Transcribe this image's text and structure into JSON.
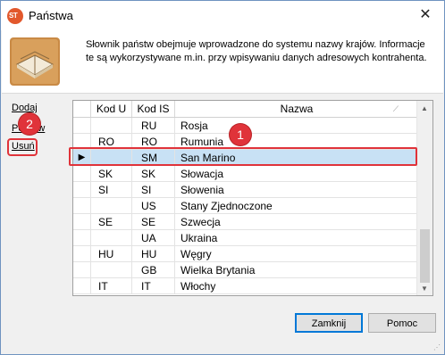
{
  "window": {
    "title": "Państwa",
    "app_icon_text": "ST"
  },
  "header": {
    "description": "Słownik państw obejmuje wprowadzone do systemu nazwy krajów. Informacje te są wykorzystywane m.in. przy wpisywaniu danych adresowych kontrahenta."
  },
  "sidebar": {
    "add": "Dodaj",
    "edit": "Popraw",
    "delete": "Usuń"
  },
  "badges": {
    "one": "1",
    "two": "2"
  },
  "grid": {
    "columns": {
      "kod_u": "Kod U",
      "kod_is": "Kod IS",
      "nazwa": "Nazwa"
    },
    "rows": [
      {
        "kod_u": "",
        "kod_is": "RU",
        "nazwa": "Rosja"
      },
      {
        "kod_u": "RO",
        "kod_is": "RO",
        "nazwa": "Rumunia"
      },
      {
        "kod_u": "",
        "kod_is": "SM",
        "nazwa": "San Marino",
        "selected": true
      },
      {
        "kod_u": "SK",
        "kod_is": "SK",
        "nazwa": "Słowacja"
      },
      {
        "kod_u": "SI",
        "kod_is": "SI",
        "nazwa": "Słowenia"
      },
      {
        "kod_u": "",
        "kod_is": "US",
        "nazwa": "Stany Zjednoczone"
      },
      {
        "kod_u": "SE",
        "kod_is": "SE",
        "nazwa": "Szwecja"
      },
      {
        "kod_u": "",
        "kod_is": "UA",
        "nazwa": "Ukraina"
      },
      {
        "kod_u": "HU",
        "kod_is": "HU",
        "nazwa": "Węgry"
      },
      {
        "kod_u": "",
        "kod_is": "GB",
        "nazwa": "Wielka Brytania"
      },
      {
        "kod_u": "IT",
        "kod_is": "IT",
        "nazwa": "Włochy"
      }
    ]
  },
  "footer": {
    "close": "Zamknij",
    "help": "Pomoc"
  },
  "colors": {
    "accent": "#0078d7",
    "highlight": "#e0333a",
    "selected_row": "#c8e1f5"
  }
}
